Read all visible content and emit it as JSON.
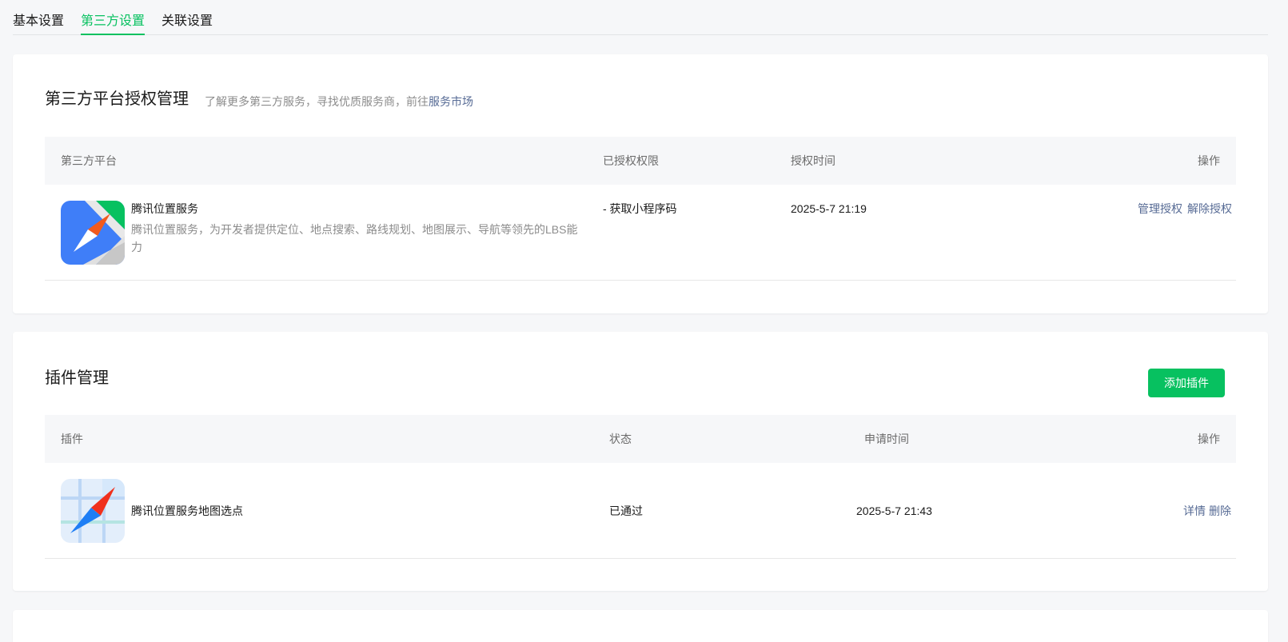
{
  "tabs": [
    {
      "label": "基本设置",
      "active": false
    },
    {
      "label": "第三方设置",
      "active": true
    },
    {
      "label": "关联设置",
      "active": false
    }
  ],
  "colors": {
    "accent": "#07c160",
    "link": "#576b95",
    "background": "#f6f7f9"
  },
  "third_party": {
    "title": "第三方平台授权管理",
    "subtitle_prefix": "了解更多第三方服务，寻找优质服务商，前往",
    "subtitle_link": "服务市场",
    "columns": [
      "第三方平台",
      "已授权权限",
      "授权时间",
      "操作"
    ],
    "rows": [
      {
        "icon": "tencent-location-service-icon",
        "name": "腾讯位置服务",
        "description": "腾讯位置服务，为开发者提供定位、地点搜索、路线规划、地图展示、导航等领先的LBS能力",
        "permission": "- 获取小程序码",
        "time": "2025-5-7 21:19",
        "actions": [
          "管理授权",
          "解除授权"
        ]
      }
    ]
  },
  "plugins": {
    "title": "插件管理",
    "add_button": "添加插件",
    "columns": [
      "插件",
      "状态",
      "申请时间",
      "操作"
    ],
    "rows": [
      {
        "icon": "map-location-picker-icon",
        "name": "腾讯位置服务地图选点",
        "status": "已通过",
        "time": "2025-5-7 21:43",
        "actions": [
          "详情",
          "删除"
        ]
      }
    ]
  }
}
